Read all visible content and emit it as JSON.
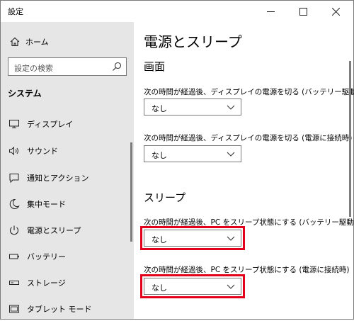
{
  "window": {
    "title": "設定"
  },
  "sidebar": {
    "home_label": "ホーム",
    "search_placeholder": "設定の検索",
    "section_label": "システム",
    "items": [
      {
        "label": "ディスプレイ",
        "icon": "monitor-icon"
      },
      {
        "label": "サウンド",
        "icon": "speaker-icon"
      },
      {
        "label": "通知とアクション",
        "icon": "notification-icon"
      },
      {
        "label": "集中モード",
        "icon": "moon-icon"
      },
      {
        "label": "電源とスリープ",
        "icon": "power-icon",
        "selected": true
      },
      {
        "label": "バッテリー",
        "icon": "battery-icon"
      },
      {
        "label": "ストレージ",
        "icon": "storage-icon"
      },
      {
        "label": "タブレット モード",
        "icon": "tablet-icon"
      }
    ]
  },
  "main": {
    "title": "電源とスリープ",
    "screen": {
      "heading": "画面",
      "battery_label": "次の時間が経過後、ディスプレイの電源を切る (バッテリー駆動時)",
      "battery_value": "なし",
      "plugged_label": "次の時間が経過後、ディスプレイの電源を切る (電源に接続時)",
      "plugged_value": "なし"
    },
    "sleep": {
      "heading": "スリープ",
      "battery_label": "次の時間が経過後、PC をスリープ状態にする (バッテリー駆動時)",
      "battery_value": "なし",
      "plugged_label": "次の時間が経過後、PC をスリープ状態にする (電源に接続時)",
      "plugged_value": "なし"
    }
  },
  "colors": {
    "sidebar_bg": "#e6e6e6",
    "highlight": "#e3001b"
  }
}
